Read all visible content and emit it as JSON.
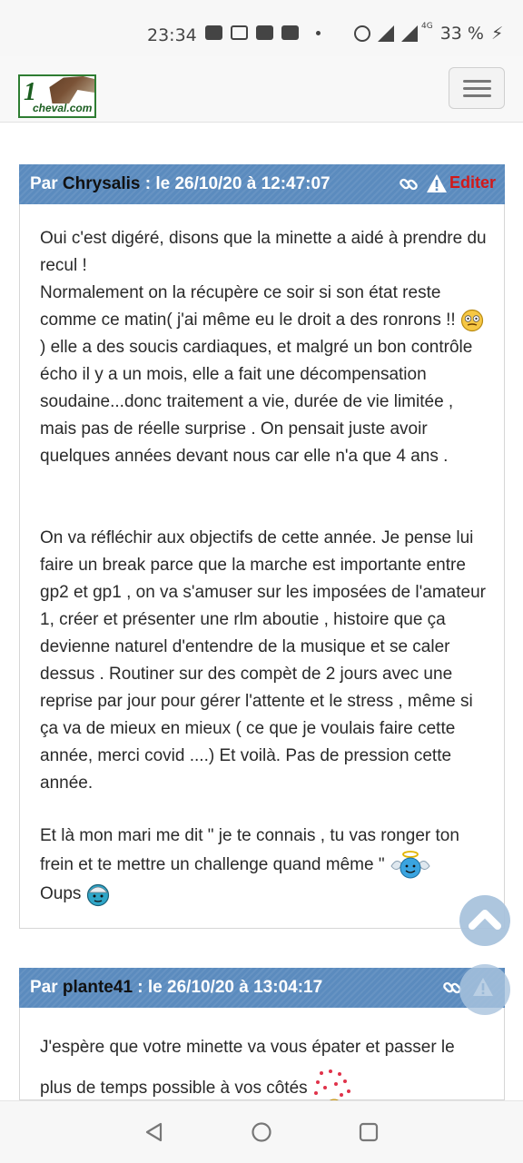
{
  "status_bar": {
    "time": "23:34",
    "battery": "33 %",
    "network": "4G",
    "icons": [
      "message-icon",
      "image-icon",
      "youtube-icon",
      "youtube-icon",
      "alarm-icon",
      "signal-icon",
      "battery-charging-icon"
    ]
  },
  "header": {
    "logo_number": "1",
    "logo_text": "cheval.com",
    "menu_icon": "hamburger-icon"
  },
  "posts": [
    {
      "prefix": "Par",
      "author": "Chrysalis",
      "date_text": ": le 26/10/20 à 12:47:07",
      "edit_label": "Editer",
      "paragraphs": [
        {
          "lines_a": "Oui c'est digéré, disons que la minette a aidé à prendre du recul !",
          "lines_b": "Normalement on la récupère ce soir si son état reste comme ce matin( j'ai même eu le droit a des ronrons !!",
          "lines_c": ") elle a des soucis cardiaques, et malgré un bon contrôle écho il y a un mois, elle a fait une décompensation soudaine...donc traitement a vie, durée de vie limitée , mais pas de réelle surprise . On pensait juste avoir quelques années devant nous car elle n'a que 4 ans ."
        },
        {
          "text": "On va réfléchir aux objectifs de cette année. Je pense lui faire un break parce que la marche est importante entre gp2 et gp1 , on va s'amuser sur les imposées de l'amateur 1, créer et présenter une rlm aboutie , histoire que ça devienne naturel d'entendre de la musique et se caler dessus . Routiner sur des compèt de 2 jours avec une reprise par jour pour gérer l'attente et le stress , même si ça va de mieux en mieux ( ce que je voulais faire cette année, merci covid ....) Et voilà. Pas de pression cette année."
        },
        {
          "text_a": "Et là mon mari me dit \" je te connais , tu vas ronger ton frein et te mettre un challenge quand même \"",
          "text_b": "Oups"
        }
      ]
    },
    {
      "prefix": "Par",
      "author": "plante41",
      "date_text": ": le 26/10/20 à 13:04:17",
      "paragraphs": [
        {
          "text": "J'espère que votre minette va vous épater et passer le plus de temps possible à vos côtés"
        }
      ]
    }
  ],
  "colors": {
    "post_header": "#5b8bbe",
    "edit": "#d21919",
    "logo_green": "#1b5e20"
  },
  "nav_bar": {
    "buttons": [
      "back-icon",
      "home-icon",
      "recents-icon"
    ]
  }
}
